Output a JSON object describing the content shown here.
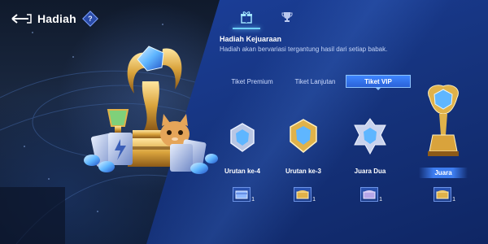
{
  "header": {
    "title": "Hadiah",
    "help_symbol": "?"
  },
  "top_tabs": [
    {
      "icon": "gift-icon",
      "selected": true
    },
    {
      "icon": "trophy-icon",
      "selected": false
    }
  ],
  "section": {
    "title": "Hadiah Kejuaraan",
    "description": "Hadiah akan bervariasi tergantung hasil dari setiap babak."
  },
  "ticket_tabs": [
    {
      "label": "Tiket Premium",
      "selected": false
    },
    {
      "label": "Tiket Lanjutan",
      "selected": false
    },
    {
      "label": "Tiket VIP",
      "selected": true
    }
  ],
  "ranks": [
    {
      "label": "Urutan ke-4",
      "badge": "silver-crest-icon",
      "reward_icon": "blue-crate-icon",
      "reward_count": "1"
    },
    {
      "label": "Urutan ke-3",
      "badge": "gold-crest-icon",
      "reward_icon": "gold-chest-icon",
      "reward_count": "1"
    },
    {
      "label": "Juara Dua",
      "badge": "silver-star-crest-icon",
      "reward_icon": "purple-chest-icon",
      "reward_count": "1"
    },
    {
      "label": "Juara",
      "badge": "gold-trophy-icon",
      "reward_icon": "gold-chest-icon",
      "reward_count": "1",
      "highlighted": true
    }
  ],
  "colors": {
    "panel": "#1b3f9a",
    "accent": "#3f86ff",
    "gold": "#e0b24a",
    "crystal": "#5fb6ff"
  }
}
